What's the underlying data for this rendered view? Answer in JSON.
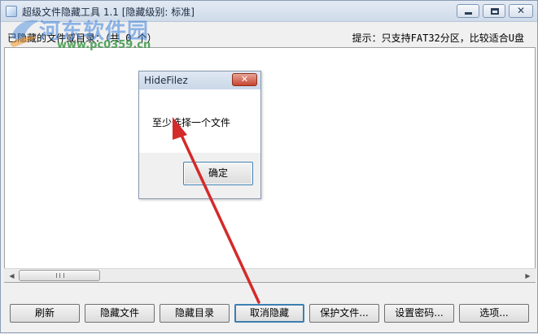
{
  "window": {
    "title": "超级文件隐藏工具 1.1  [隐藏级别: 标准]"
  },
  "watermark": {
    "name": "河东软件园",
    "url": "www.pc0359.cn"
  },
  "info": {
    "hidden_label": "已隐藏的文件或目录：（共 0 个）",
    "hint": "提示：只支持FAT32分区，比较适合U盘"
  },
  "scrollbar": {
    "grip": "III"
  },
  "buttons": {
    "refresh": "刷新",
    "hide_file": "隐藏文件",
    "hide_dir": "隐藏目录",
    "unhide": "取消隐藏",
    "protect_file": "保护文件...",
    "set_password": "设置密码...",
    "options": "选项..."
  },
  "dialog": {
    "title": "HideFilez",
    "message": "至少选择一个文件",
    "ok": "确定",
    "close_glyph": "✕"
  },
  "icons": {
    "close_glyph": "✕",
    "scroll_left": "◀",
    "scroll_right": "▶"
  },
  "colors": {
    "annotation_arrow": "#d42a2a",
    "dialog_close": "#c9452f",
    "button_focus": "#3c7fb1"
  }
}
